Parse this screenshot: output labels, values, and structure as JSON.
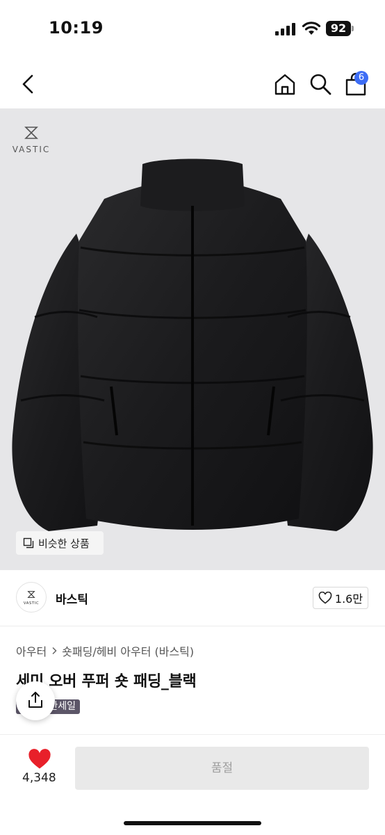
{
  "status_bar": {
    "time": "10:19",
    "battery": "92"
  },
  "nav": {
    "cart_count": "6"
  },
  "hero": {
    "brand_mark": "VASTIC",
    "similar_label": "비슷한 상품"
  },
  "store": {
    "logo_text": "VASTIC",
    "name": "바스틱",
    "likes": "1.6만"
  },
  "breadcrumb": {
    "items": [
      "아우터",
      "숏패딩/헤비 아우터 (바스틱)"
    ]
  },
  "product": {
    "title": "세미 오버 푸퍼 숏 패딩_블랙",
    "tag": "한세일"
  },
  "bottom": {
    "like_count": "4,348",
    "soldout_label": "품절"
  },
  "colors": {
    "accent": "#3d6df5",
    "like_red": "#e8202a",
    "tag_bg": "#5c5668"
  },
  "icons": [
    "back-chevron-icon",
    "home-icon",
    "search-icon",
    "cart-icon",
    "similar-items-icon",
    "heart-outline-icon",
    "share-icon",
    "heart-filled-icon"
  ]
}
